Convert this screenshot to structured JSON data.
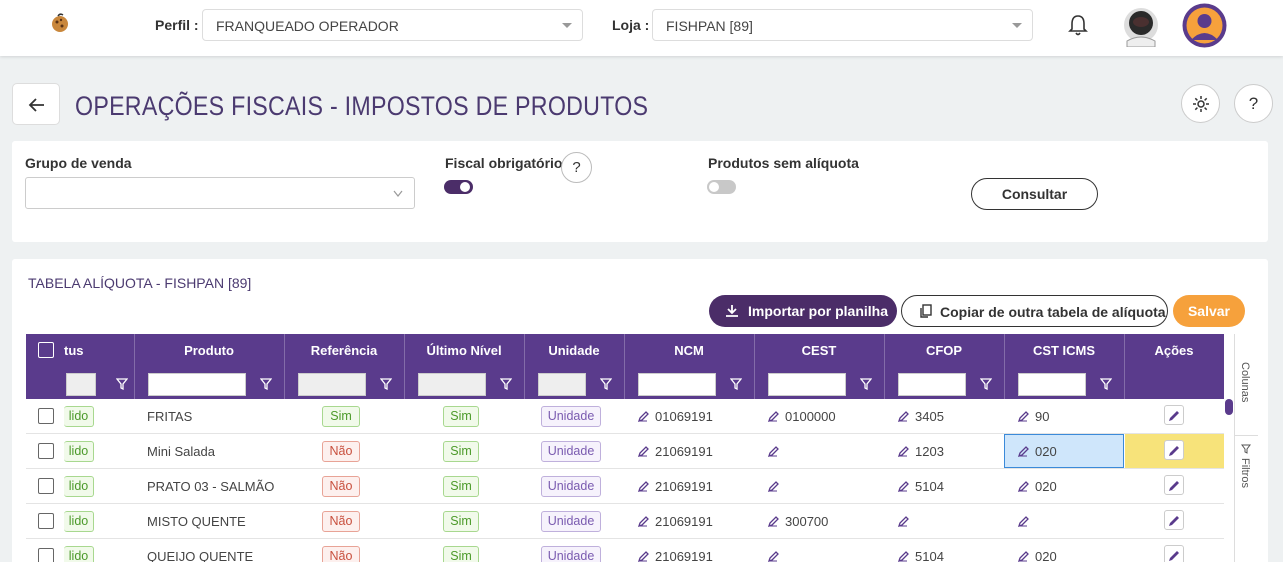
{
  "header": {
    "perfil_label": "Perfil :",
    "perfil_value": "FRANQUEADO OPERADOR",
    "loja_label": "Loja :",
    "loja_value": "FISHPAN [89]"
  },
  "page": {
    "title": "OPERAÇÕES FISCAIS - IMPOSTOS DE PRODUTOS"
  },
  "filters": {
    "grupo_label": "Grupo de venda",
    "fiscal_label": "Fiscal obrigatório",
    "fiscal_help": "?",
    "fiscal_enabled": true,
    "sem_aliquota_label": "Produtos sem alíquota",
    "sem_aliquota_enabled": false,
    "consultar_label": "Consultar"
  },
  "table_section": {
    "title": "TABELA ALÍQUOTA - FISHPAN [89]",
    "import_label": "Importar por planilha",
    "copy_label": "Copiar de outra tabela de alíquota",
    "save_label": "Salvar",
    "columns": [
      "tus",
      "Produto",
      "Referência",
      "Último Nível",
      "Unidade",
      "NCM",
      "CEST",
      "CFOP",
      "CST ICMS",
      "Ações"
    ],
    "side_tabs": [
      "Colunas",
      "Filtros"
    ],
    "rows": [
      {
        "status": "lido",
        "produto": "FRITAS",
        "referencia": "Sim",
        "ultimo_nivel": "Sim",
        "unidade": "Unidade",
        "ncm": "01069191",
        "cest": "0100000",
        "cfop": "3405",
        "cst_icms": "90"
      },
      {
        "status": "lido",
        "produto": "Mini Salada",
        "referencia": "Não",
        "ultimo_nivel": "Sim",
        "unidade": "Unidade",
        "ncm": "21069191",
        "cest": "",
        "cfop": "1203",
        "cst_icms": "020"
      },
      {
        "status": "lido",
        "produto": "PRATO 03 - SALMÃO",
        "referencia": "Não",
        "ultimo_nivel": "Sim",
        "unidade": "Unidade",
        "ncm": "21069191",
        "cest": "",
        "cfop": "5104",
        "cst_icms": "020"
      },
      {
        "status": "lido",
        "produto": "MISTO QUENTE",
        "referencia": "Não",
        "ultimo_nivel": "Sim",
        "unidade": "Unidade",
        "ncm": "21069191",
        "cest": "300700",
        "cfop": "",
        "cst_icms": ""
      },
      {
        "status": "lido",
        "produto": "QUEIJO QUENTE",
        "referencia": "Não",
        "ultimo_nivel": "Sim",
        "unidade": "Unidade",
        "ncm": "21069191",
        "cest": "",
        "cfop": "5104",
        "cst_icms": "020"
      }
    ]
  },
  "colors": {
    "primary": "#5a3b8c",
    "title": "#4b3a70",
    "accent": "#f6a13c",
    "selected_cell": "#cfe6fb",
    "highlight_row": "#f7e37a"
  }
}
